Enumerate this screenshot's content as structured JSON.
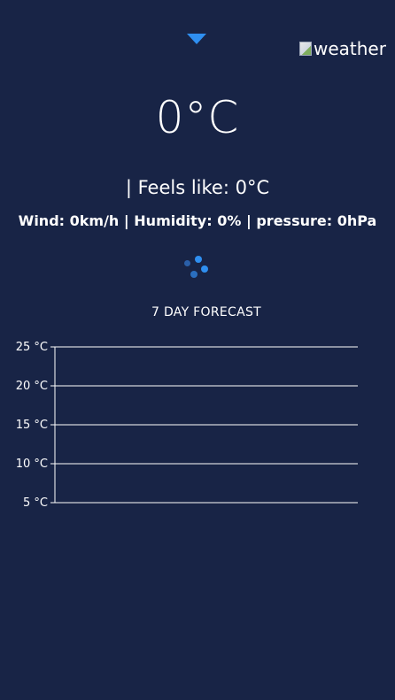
{
  "header": {
    "dropdown_icon": "caret-down-icon",
    "weather_image_alt": "weather"
  },
  "current": {
    "temperature": "0°C",
    "feels_like": "| Feels like: 0°C",
    "details": "Wind: 0km/h | Humidity: 0% | pressure: 0hPa"
  },
  "loading": {
    "icon": "loading-spinner-icon",
    "color": "#2f8ff0"
  },
  "forecast": {
    "title": "7 DAY FORECAST"
  },
  "chart_data": {
    "type": "line",
    "title": "",
    "xlabel": "",
    "ylabel": "",
    "ylim": [
      5,
      25
    ],
    "yticks": [
      "25 °C",
      "20 °C",
      "15 °C",
      "10 °C",
      "5 °C"
    ],
    "ytick_values": [
      25,
      20,
      15,
      10,
      5
    ],
    "grid": true,
    "series": []
  },
  "colors": {
    "background": "#182446",
    "accent": "#2f8ff0",
    "text": "#ffffff"
  }
}
